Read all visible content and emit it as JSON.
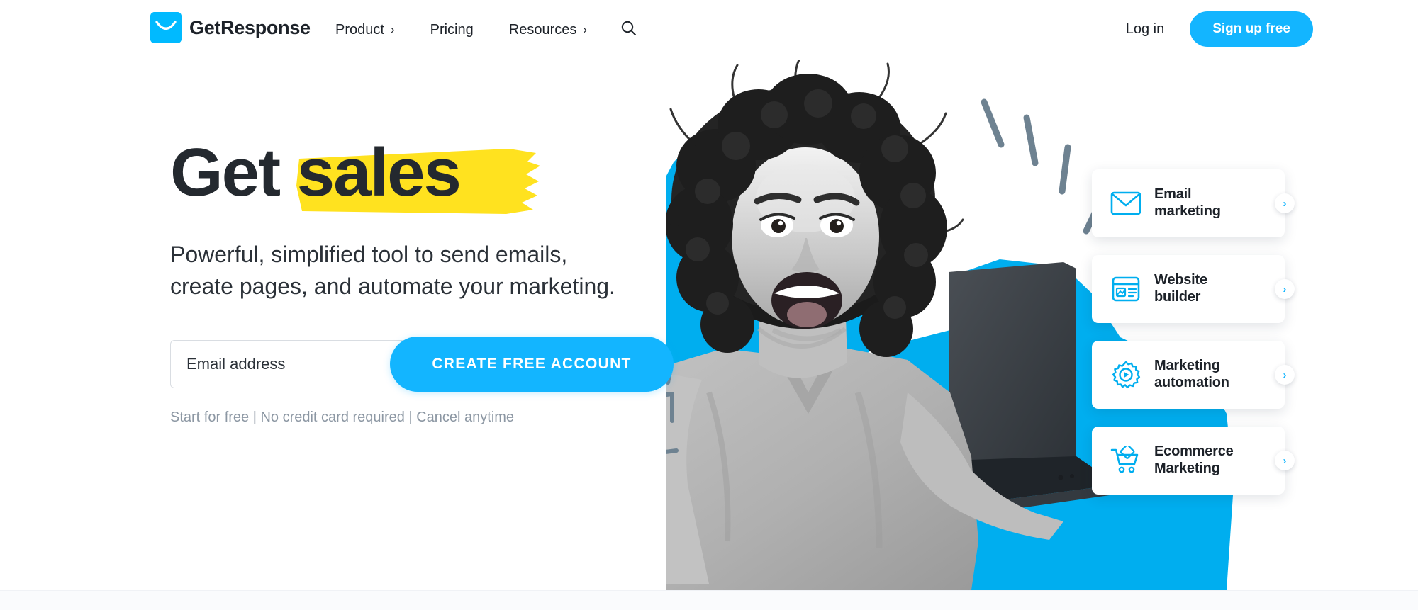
{
  "header": {
    "brand_name": "GetResponse",
    "brand_logo_icon": "getresponse-envelope-logo",
    "nav_items": [
      {
        "label": "Product",
        "has_chevron": true,
        "chevron": "›"
      },
      {
        "label": "Pricing",
        "has_chevron": false,
        "chevron": ""
      },
      {
        "label": "Resources",
        "has_chevron": true,
        "chevron": "›"
      }
    ],
    "search_icon": "search-icon",
    "login_label": "Log in",
    "signup_label": "Sign up free"
  },
  "hero": {
    "headline_part1": "Get ",
    "headline_highlight": "sales",
    "subheadline_line1": "Powerful, simplified tool to send emails,",
    "subheadline_line2": "create pages, and automate your marketing.",
    "email_placeholder": "Email address",
    "email_value": "",
    "cta_label": "CREATE FREE ACCOUNT",
    "fineprint": "Start for free | No credit card required | Cancel anytime"
  },
  "feature_cards": [
    {
      "label_line1": "Email",
      "label_line2": "marketing",
      "icon": "envelope-icon",
      "chevron": "›"
    },
    {
      "label_line1": "Website",
      "label_line2": "builder",
      "icon": "browser-window-icon",
      "chevron": "›"
    },
    {
      "label_line1": "Marketing",
      "label_line2": "automation",
      "icon": "gear-play-icon",
      "chevron": "›"
    },
    {
      "label_line1": "Ecommerce",
      "label_line2": "Marketing",
      "icon": "shopping-cart-icon",
      "chevron": "›"
    }
  ],
  "artwork": {
    "subject": "excited-woman-with-laptop-photo",
    "decorations": [
      "bar-chart-doodle",
      "excitement-dashes"
    ]
  },
  "colors": {
    "brand_cyan": "#00BAFF",
    "button_blue": "#13B5FF",
    "highlight_yellow": "#FFE21F",
    "text_dark": "#24292f",
    "text_muted": "#8c97a3",
    "doodle_gray": "#6e8291"
  }
}
